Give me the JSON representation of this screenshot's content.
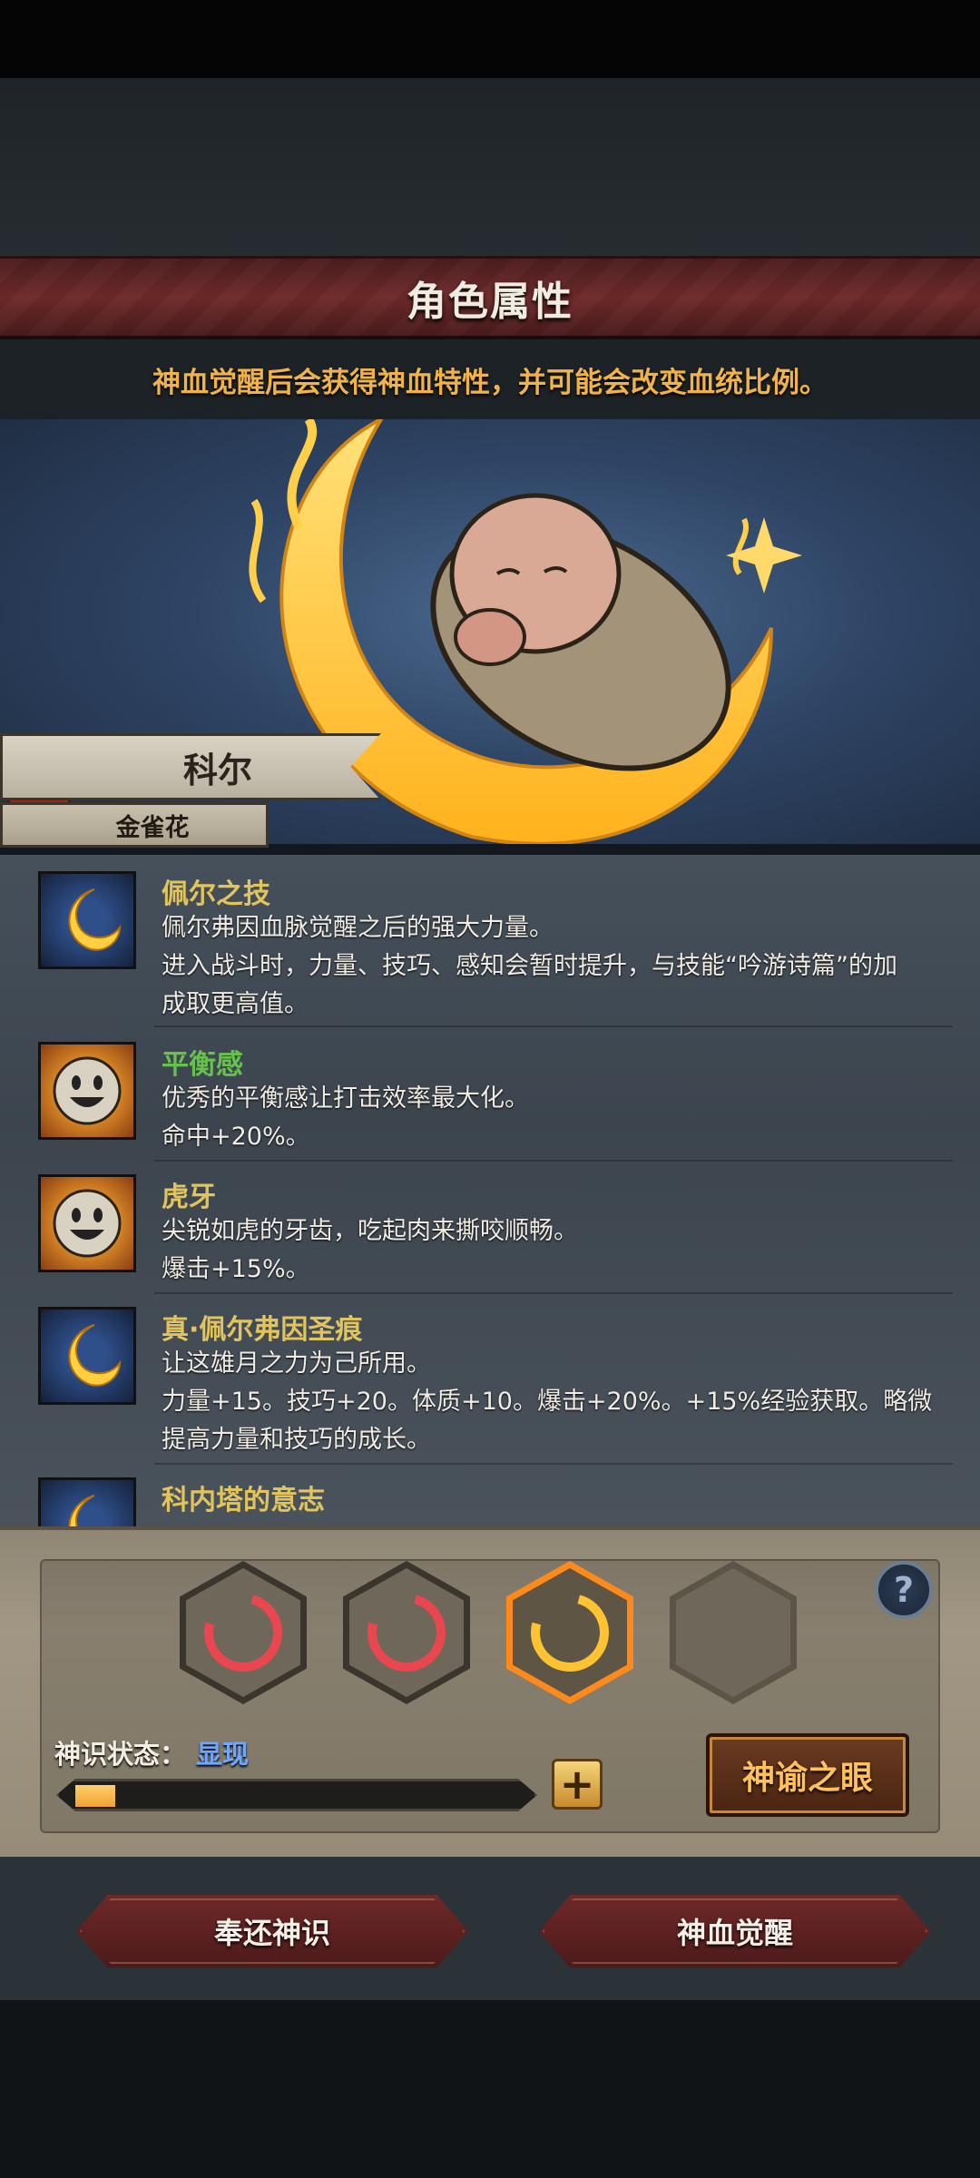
{
  "header": {
    "title": "角色属性",
    "info": "神血觉醒后会获得神血特性，并可能会改变血统比例。"
  },
  "character": {
    "name": "科尔",
    "subtitle": "金雀花"
  },
  "skills": [
    {
      "name": "佩尔之技",
      "name_color": "#e2c45c",
      "icon": "crescent-moon-icon",
      "lines": [
        "佩尔弗因血脉觉醒之后的强大力量。",
        "进入战斗时，力量、技巧、感知会暂时提升，与技能“吟游诗篇”的加",
        "成取更高值。"
      ]
    },
    {
      "name": "平衡感",
      "name_color": "#66c24c",
      "icon": "smiling-face-icon",
      "lines": [
        "优秀的平衡感让打击效率最大化。",
        "命中+20%。"
      ]
    },
    {
      "name": "虎牙",
      "name_color": "#e2c45c",
      "icon": "smiling-face-icon",
      "lines": [
        "尖锐如虎的牙齿，吃起肉来撕咬顺畅。",
        "爆击+15%。"
      ]
    },
    {
      "name": "真·佩尔弗因圣痕",
      "name_color": "#e2c45c",
      "icon": "crescent-moon-icon",
      "lines": [
        "让这雄月之力为己所用。",
        "力量+15。技巧+20。体质+10。爆击+20%。+15%经验获取。略微",
        "提高力量和技巧的成长。"
      ]
    },
    {
      "name": "科内塔的意志",
      "name_color": "#e2c45c",
      "icon": "crescent-moon-icon",
      "lines": []
    }
  ],
  "slots": [
    {
      "state": "red",
      "color": "#e8474f"
    },
    {
      "state": "red",
      "color": "#e8474f"
    },
    {
      "state": "gold",
      "color": "#ffc233"
    },
    {
      "state": "empty",
      "color": "#6f675a"
    }
  ],
  "status": {
    "label": "神识状态：",
    "value": "显现",
    "progress": 0.09
  },
  "buttons": {
    "oracle": "神谕之眼",
    "return": "奉还神识",
    "awaken": "神血觉醒",
    "plus": "+",
    "help": "?"
  }
}
